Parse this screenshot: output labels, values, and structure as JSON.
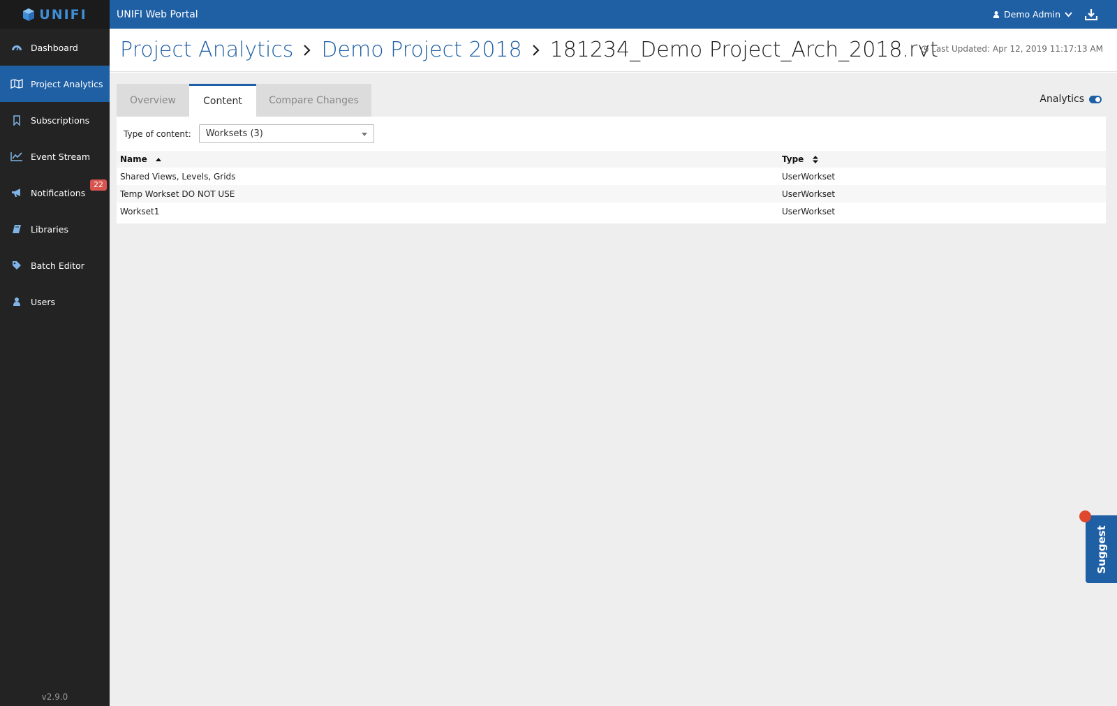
{
  "app": {
    "logo_text": "UNIFI",
    "portal_title": "UNIFI Web Portal",
    "version": "v2.9.0",
    "accent_color": "#1f5fa4"
  },
  "user_menu": {
    "name": "Demo Admin"
  },
  "sidebar": {
    "items": [
      {
        "label": "Dashboard",
        "icon": "dashboard-icon"
      },
      {
        "label": "Project Analytics",
        "icon": "map-icon"
      },
      {
        "label": "Subscriptions",
        "icon": "bookmark-icon"
      },
      {
        "label": "Event Stream",
        "icon": "line-chart-icon"
      },
      {
        "label": "Notifications",
        "icon": "bullhorn-icon",
        "badge": "22"
      },
      {
        "label": "Libraries",
        "icon": "book-icon"
      },
      {
        "label": "Batch Editor",
        "icon": "tag-icon"
      },
      {
        "label": "Users",
        "icon": "user-icon"
      }
    ]
  },
  "breadcrumb": {
    "level1": "Project Analytics",
    "level2": "Demo Project 2018",
    "current": "181234_Demo Project_Arch_2018.rvt"
  },
  "last_updated": "Last Updated: Apr 12, 2019 11:17:13 AM",
  "tabs": [
    {
      "label": "Overview"
    },
    {
      "label": "Content"
    },
    {
      "label": "Compare Changes"
    }
  ],
  "analytics_toggle": {
    "label": "Analytics"
  },
  "filter": {
    "label": "Type of content:",
    "selected": "Worksets (3)"
  },
  "table": {
    "headers": {
      "name": "Name",
      "type": "Type"
    },
    "rows": [
      {
        "name": "Shared Views, Levels, Grids",
        "type": "UserWorkset"
      },
      {
        "name": "Temp Workset DO NOT USE",
        "type": "UserWorkset"
      },
      {
        "name": "Workset1",
        "type": "UserWorkset"
      }
    ]
  },
  "suggest": {
    "label": "Suggest"
  }
}
